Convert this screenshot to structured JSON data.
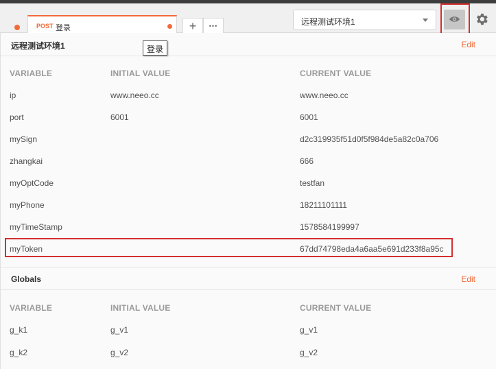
{
  "tab": {
    "method": "POST",
    "name": "登录",
    "add_label": "+",
    "more_label": "•••"
  },
  "environment": {
    "selected": "远程测试环境1"
  },
  "tooltip": {
    "text": "登录"
  },
  "env_section": {
    "title": "远程测试环境1",
    "edit_label": "Edit",
    "columns": [
      "VARIABLE",
      "INITIAL VALUE",
      "CURRENT VALUE"
    ],
    "rows": [
      {
        "variable": "ip",
        "initial": "www.neeo.cc",
        "current": "www.neeo.cc"
      },
      {
        "variable": "port",
        "initial": "6001",
        "current": "6001"
      },
      {
        "variable": "mySign",
        "initial": "",
        "current": "d2c319935f51d0f5f984de5a82c0a706"
      },
      {
        "variable": "zhangkai",
        "initial": "",
        "current": "666"
      },
      {
        "variable": "myOptCode",
        "initial": "",
        "current": "testfan"
      },
      {
        "variable": "myPhone",
        "initial": "",
        "current": "18211101111"
      },
      {
        "variable": "myTimeStamp",
        "initial": "",
        "current": "1578584199997"
      },
      {
        "variable": "myToken",
        "initial": "",
        "current": "67dd74798eda4a6aa5e691d233f8a95c"
      }
    ]
  },
  "globals_section": {
    "title": "Globals",
    "edit_label": "Edit",
    "columns": [
      "VARIABLE",
      "INITIAL VALUE",
      "CURRENT VALUE"
    ],
    "rows": [
      {
        "variable": "g_k1",
        "initial": "g_v1",
        "current": "g_v1"
      },
      {
        "variable": "g_k2",
        "initial": "g_v2",
        "current": "g_v2"
      }
    ]
  },
  "colors": {
    "accent": "#f26b3a",
    "highlight": "#d32f2f"
  },
  "icons": {
    "eye": "eye-icon",
    "gear": "gear-icon",
    "caret": "chevron-down-icon"
  }
}
